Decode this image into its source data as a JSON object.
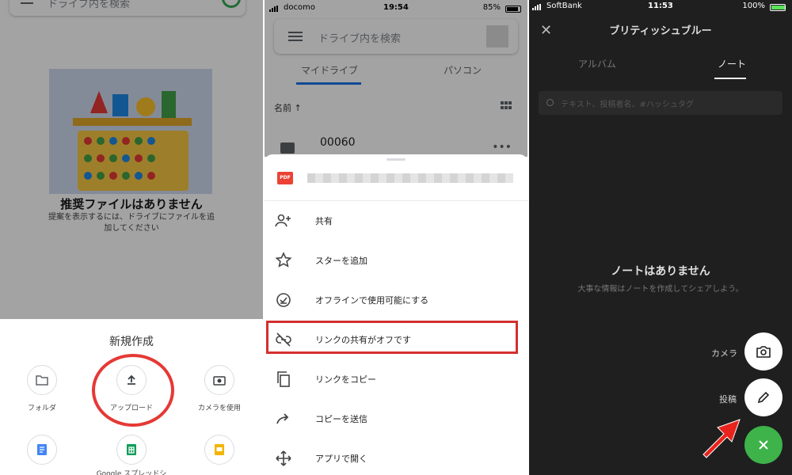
{
  "panel1": {
    "search_placeholder": "ドライブ内を検索",
    "empty_title": "推奨ファイルはありません",
    "empty_sub": "提案を表示するには、ドライブにファイルを追加してください",
    "sheet_title": "新規作成",
    "tiles": [
      {
        "label": "フォルダ",
        "icon": "folder-icon"
      },
      {
        "label": "アップロード",
        "icon": "upload-icon"
      },
      {
        "label": "カメラを使用",
        "icon": "camera-icon"
      }
    ],
    "bottom_label": "Google スプレッドシート",
    "colors": {
      "accent_red": "#e53935"
    }
  },
  "panel2": {
    "status": {
      "carrier": "docomo",
      "time": "19:54",
      "battery": "85%"
    },
    "search_placeholder": "ドライブ内を検索",
    "tabs": [
      "マイドライブ",
      "パソコン"
    ],
    "sort_label": "名前 ↑",
    "file_name": "00060",
    "file_badge": "PDF",
    "menu": [
      {
        "label": "共有",
        "icon": "add-person-icon"
      },
      {
        "label": "スターを追加",
        "icon": "star-icon"
      },
      {
        "label": "オフラインで使用可能にする",
        "icon": "offline-icon"
      },
      {
        "label": "リンクの共有がオフです",
        "icon": "link-off-icon"
      },
      {
        "label": "リンクをコピー",
        "icon": "copy-icon"
      },
      {
        "label": "コピーを送信",
        "icon": "share-arrow-icon"
      },
      {
        "label": "アプリで開く",
        "icon": "open-with-icon"
      }
    ],
    "colors": {
      "highlight_red": "#d32f2f",
      "tab_blue": "#1a73e8"
    }
  },
  "panel3": {
    "status": {
      "carrier": "SoftBank",
      "time": "11:53",
      "battery": "100%"
    },
    "title": "ブリティッシュブルー",
    "tabs": [
      "アルバム",
      "ノート"
    ],
    "search_placeholder": "テキスト、投稿者名、#ハッシュタグ",
    "empty_title": "ノートはありません",
    "empty_sub": "大事な情報はノートを作成してシェアしよう。",
    "fab_camera_label": "カメラ",
    "fab_post_label": "投稿",
    "colors": {
      "fab_green": "#3db34a",
      "background": "#1f1f1f"
    }
  }
}
